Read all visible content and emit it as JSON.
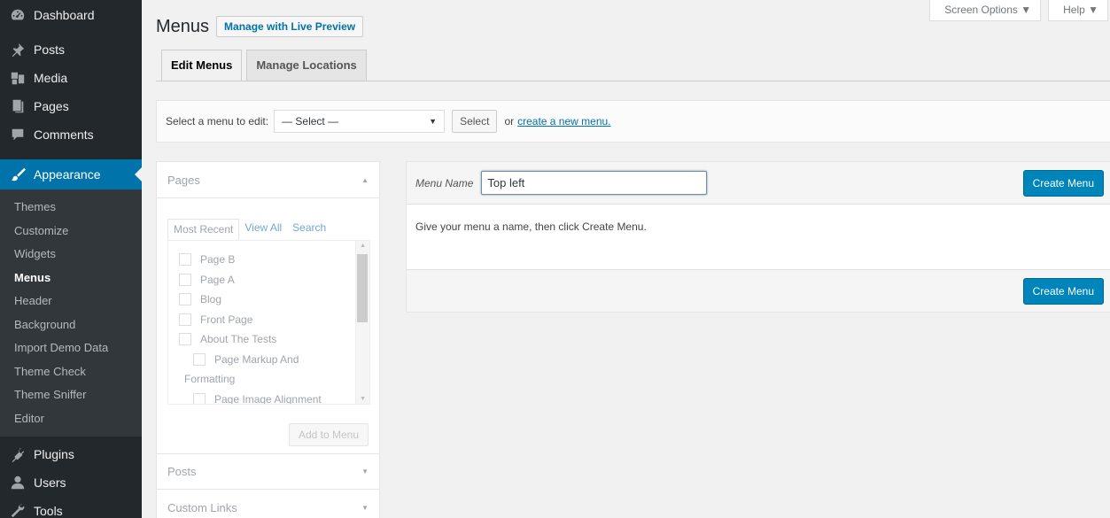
{
  "sidebar": {
    "top_items": [
      {
        "label": "Dashboard",
        "icon": "dashboard-icon"
      },
      {
        "label": "Posts",
        "icon": "pin-icon"
      },
      {
        "label": "Media",
        "icon": "media-icon"
      },
      {
        "label": "Pages",
        "icon": "pages-icon"
      },
      {
        "label": "Comments",
        "icon": "comments-icon"
      }
    ],
    "active": {
      "label": "Appearance",
      "icon": "paintbrush-icon"
    },
    "submenu": [
      "Themes",
      "Customize",
      "Widgets",
      "Menus",
      "Header",
      "Background",
      "Import Demo Data",
      "Theme Check",
      "Theme Sniffer",
      "Editor"
    ],
    "current_sub": "Menus",
    "bottom_items": [
      {
        "label": "Plugins",
        "icon": "plugin-icon"
      },
      {
        "label": "Users",
        "icon": "users-icon"
      },
      {
        "label": "Tools",
        "icon": "tools-icon"
      }
    ]
  },
  "screen_meta": {
    "screen_options": "Screen Options ▼",
    "help": "Help ▼"
  },
  "header": {
    "title": "Menus",
    "live_preview": "Manage with Live Preview"
  },
  "tabs": [
    "Edit Menus",
    "Manage Locations"
  ],
  "manage": {
    "label": "Select a menu to edit:",
    "select_value": "— Select —",
    "select_button": "Select",
    "or_text": "or",
    "create_link": "create a new menu."
  },
  "pages_box": {
    "title": "Pages",
    "tabs": [
      "Most Recent",
      "View All",
      "Search"
    ],
    "items": [
      "Page B",
      "Page A",
      "Blog",
      "Front Page",
      "About The Tests"
    ],
    "child_item_line1": "Page Markup And",
    "child_item_line2": "Formatting",
    "child_item_last": "Page Image Alignment",
    "add_button": "Add to Menu"
  },
  "posts_box": {
    "title": "Posts"
  },
  "custom_links_box": {
    "title": "Custom Links"
  },
  "edit_menu": {
    "name_label": "Menu Name",
    "name_value": "Top left",
    "create_button": "Create Menu",
    "instructions": "Give your menu a name, then click Create Menu."
  }
}
